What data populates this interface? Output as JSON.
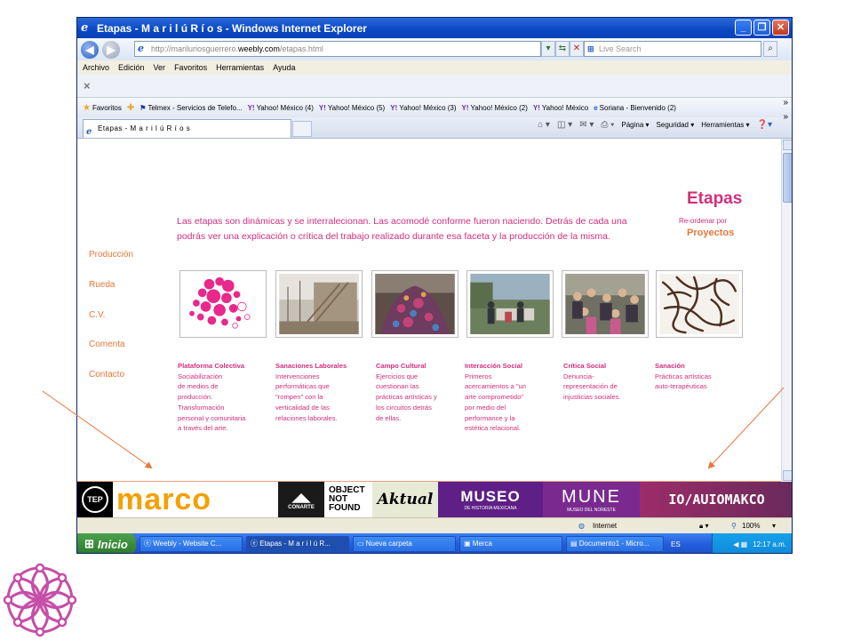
{
  "window": {
    "title": "Etapas - M a r i l ú R í o s - Windows Internet Explorer",
    "min_label": "_",
    "max_label": "❐",
    "close_label": "✕"
  },
  "address": {
    "url_prefix": "http://mariluriosguerrero.",
    "url_domain": "weebly.com",
    "url_path": "/etapas.html",
    "search_placeholder": "Live Search"
  },
  "menu": [
    "Archivo",
    "Edición",
    "Ver",
    "Favoritos",
    "Herramientas",
    "Ayuda"
  ],
  "xbar_label": "×",
  "favorites": {
    "label": "Favoritos",
    "items": [
      "Telmex - Servicios de Telefo...",
      "Yahoo! México (4)",
      "Yahoo! México (5)",
      "Yahoo! México (3)",
      "Yahoo! México (2)",
      "Yahoo! México",
      "Soriana - Bienvenido (2)"
    ],
    "more": "»"
  },
  "tabs": {
    "active_label": "Etapas - M a r i l ú R í o s",
    "commands": [
      "Página ▾",
      "Seguridad ▾",
      "Herramientas ▾"
    ]
  },
  "page": {
    "nav": [
      "Producción",
      "Rueda",
      "C.V.",
      "Comenta",
      "Contacto"
    ],
    "intro": "Las etapas son dinámicas y se interralecionan. Las acomodé conforme fueron naciendo. Detrás de cada una podrás ver una explicación o crítica del trabajo realizado durante esa faceta y la producción de la misma.",
    "title": "Etapas",
    "reorder_label": "Re-ordenar por",
    "sort_value": "Proyectos",
    "projects": [
      {
        "title": "Plataforma Colectiva",
        "lines": [
          "Sociabilización",
          "de medios de",
          "producción.",
          "Transformación",
          "personal y comunitaria",
          "a través del arte."
        ]
      },
      {
        "title": "Sanaciones Laborales",
        "lines": [
          "Intervenciones",
          "performáticas que",
          "\"rompen\" con la",
          "verticalidad de las",
          "relaciones laborales."
        ]
      },
      {
        "title": "Campo Cultural",
        "lines": [
          "Ejercicios que",
          "cuestionan las",
          "prácticas artísticas y",
          "los circuitos detrás",
          "de ellas."
        ]
      },
      {
        "title": "Interacción Social",
        "lines": [
          "Primeros",
          "acercamientos a \"un",
          "arte comprometido\"",
          "por medio del",
          "performance y la",
          "estética relacional."
        ]
      },
      {
        "title": "Crítica Social",
        "lines": [
          "Denuncia-",
          "representación de",
          "injusticias sociales."
        ]
      },
      {
        "title": "Sanación",
        "lines": [
          "Prácticas artísticas",
          "auto-terapéuticas"
        ]
      }
    ]
  },
  "logos": {
    "tep": "TEP",
    "marco": "marco",
    "conarte": "CONARTE",
    "object": [
      "OBJECT",
      "NOT",
      "FOUND"
    ],
    "aktual": "Aktual",
    "museo": "MUSEO",
    "museo_sub": "DE HISTORIA MEXICANA",
    "mune": "MUNE",
    "mune_sub": "MUSEO DEL NORESTE",
    "last": "IO/AUIOMAKCO"
  },
  "status": {
    "zone": "Internet",
    "zoom": "100%"
  },
  "taskbar": {
    "start": "Inicio",
    "items": [
      "Weebly - Website C...",
      "Etapas - M a r i l ú R...",
      "Nueva carpeta",
      "Merca",
      "Documento1 - Micro..."
    ],
    "lang": "ES",
    "clock": "12:17 a.m."
  },
  "colors": {
    "pink": "#d22f7b",
    "orange": "#e8773a",
    "magenta_logo": "#c54fa8"
  }
}
